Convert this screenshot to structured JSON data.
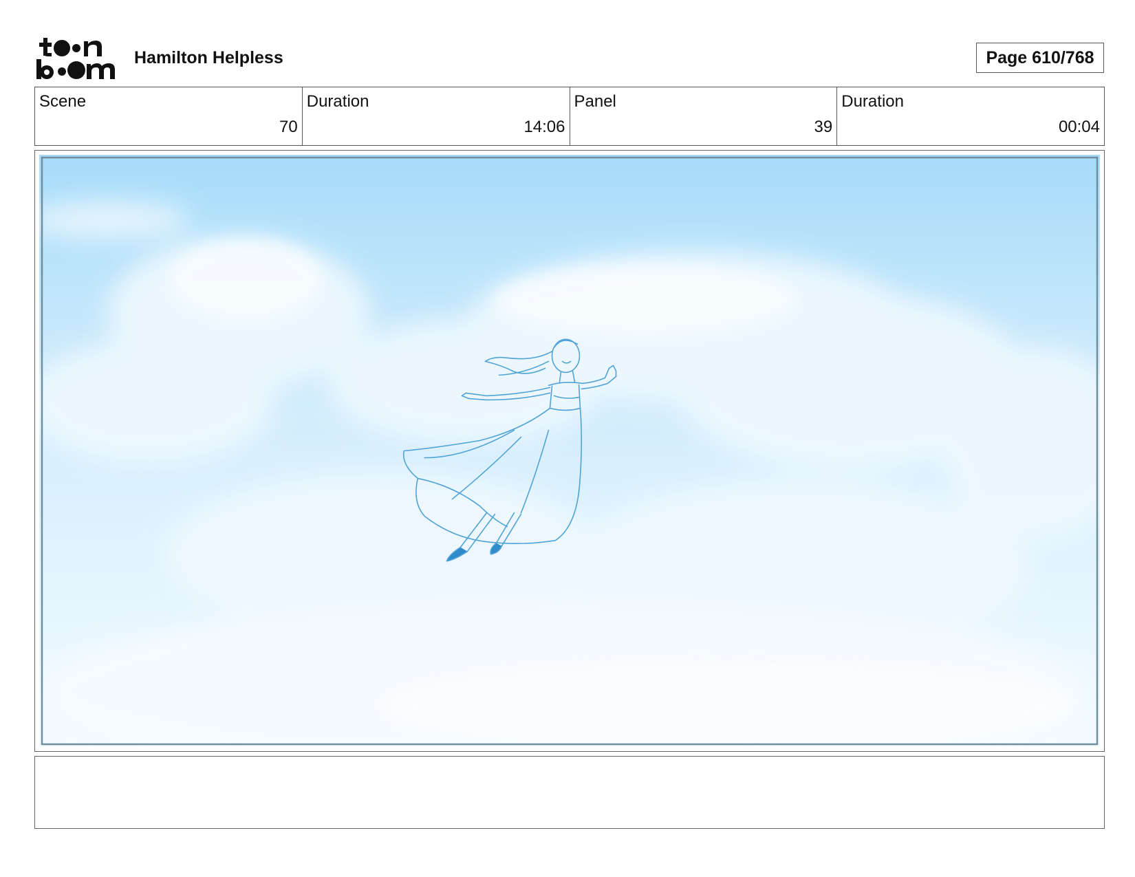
{
  "header": {
    "logo_text": "toon boom",
    "project_title": "Hamilton Helpless",
    "page_label": "Page 610/768"
  },
  "info": {
    "scene_label": "Scene",
    "scene_value": "70",
    "scene_duration_label": "Duration",
    "scene_duration_value": "14:06",
    "panel_label": "Panel",
    "panel_value": "39",
    "panel_duration_label": "Duration",
    "panel_duration_value": "00:04"
  },
  "colors": {
    "sky_top": "#a6dcfa",
    "sky_bottom": "#f4fbff",
    "sketch_line": "#4fa3d6",
    "frame_border": "#6f8ea0"
  },
  "notes": {
    "text": ""
  }
}
